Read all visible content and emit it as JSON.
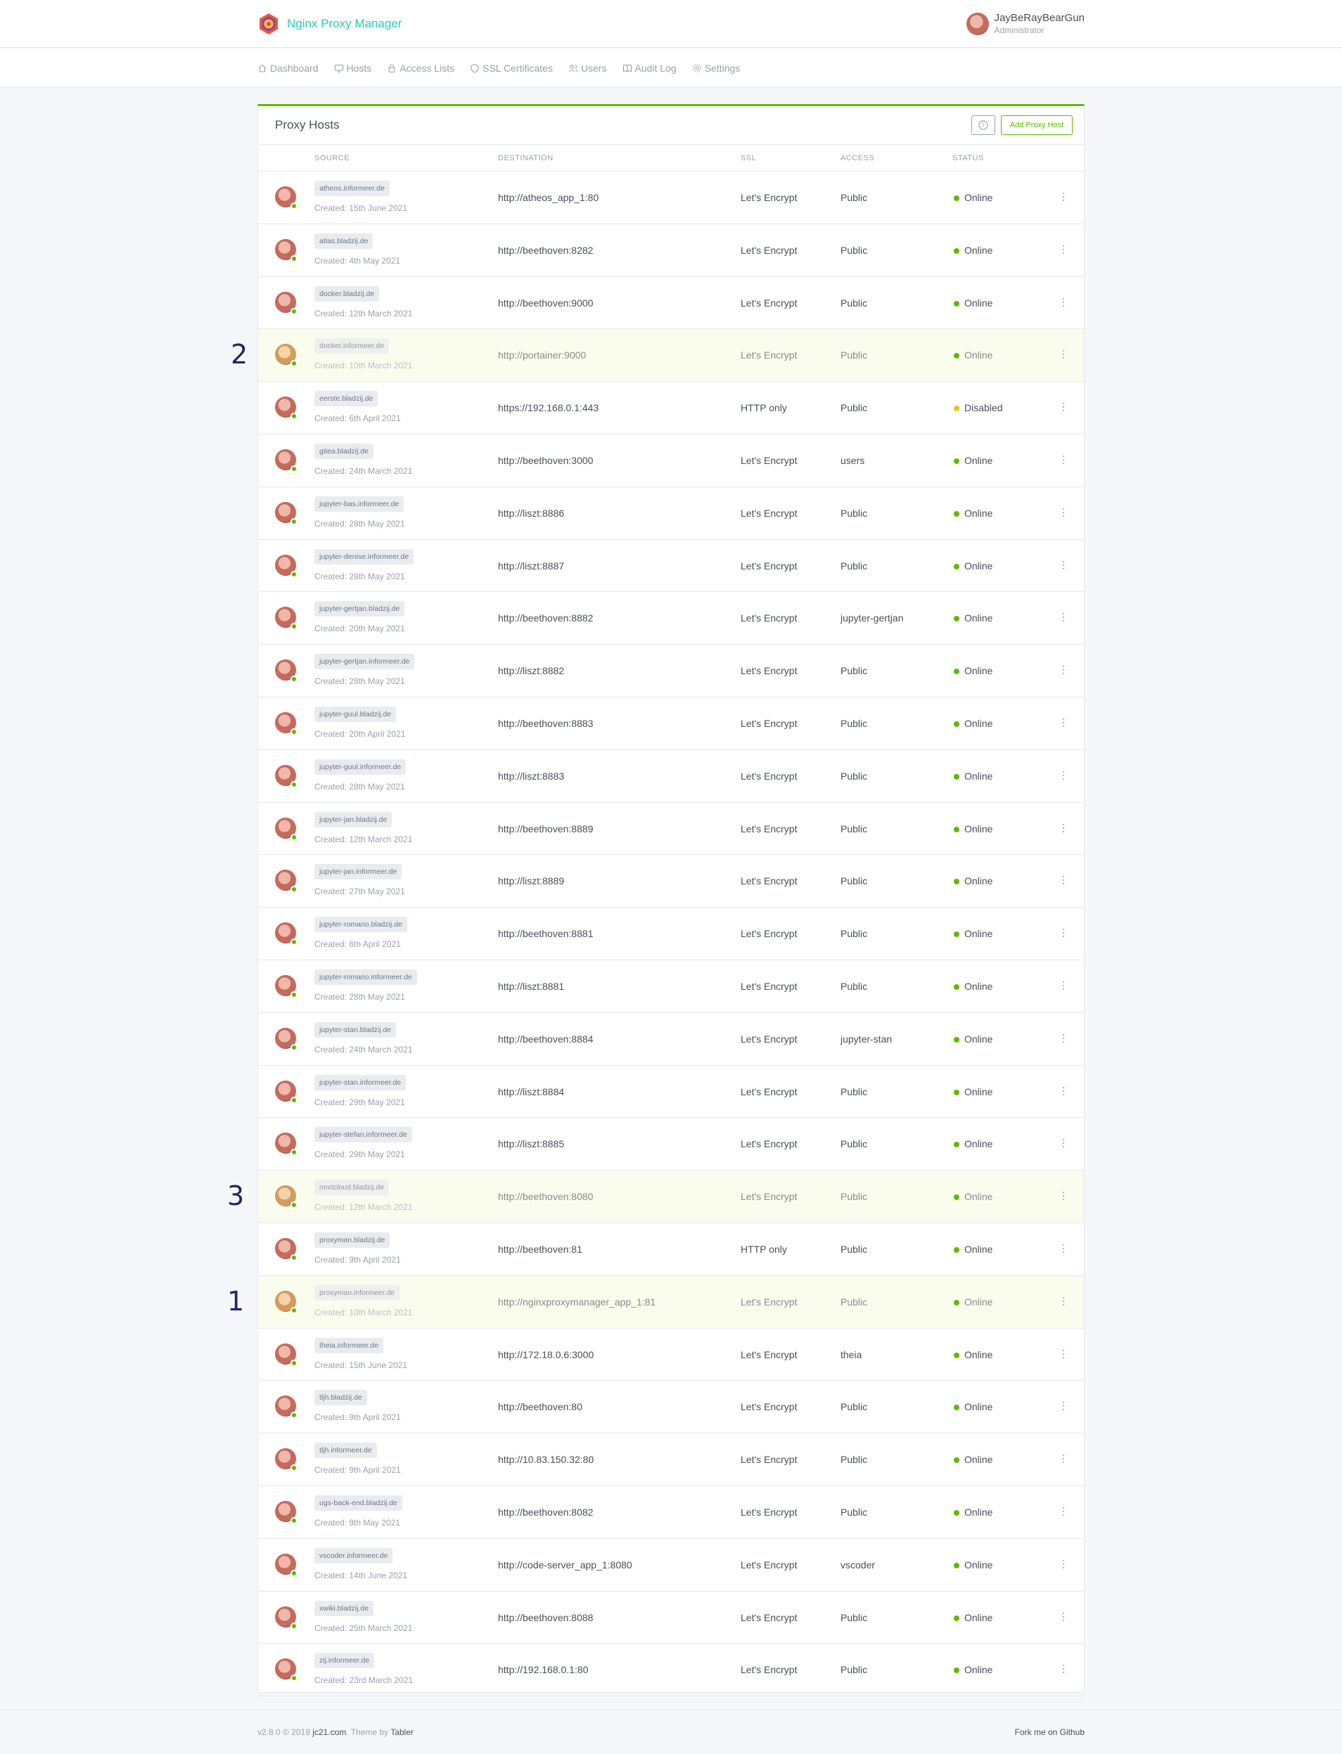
{
  "app": {
    "name": "Nginx Proxy Manager",
    "user_name": "JayBeRayBearGun",
    "user_role": "Administrator"
  },
  "nav": [
    {
      "label": "Dashboard",
      "icon": "home-icon"
    },
    {
      "label": "Hosts",
      "icon": "monitor-icon"
    },
    {
      "label": "Access Lists",
      "icon": "lock-icon"
    },
    {
      "label": "SSL Certificates",
      "icon": "shield-icon"
    },
    {
      "label": "Users",
      "icon": "users-icon"
    },
    {
      "label": "Audit Log",
      "icon": "book-icon"
    },
    {
      "label": "Settings",
      "icon": "gear-icon"
    }
  ],
  "card": {
    "title": "Proxy Hosts",
    "add_label": "Add Proxy Host"
  },
  "columns": [
    "SOURCE",
    "DESTINATION",
    "SSL",
    "ACCESS",
    "STATUS"
  ],
  "rows": [
    {
      "domain": "atheos.informeer.de",
      "created": "Created: 15th June 2021",
      "destination": "http://atheos_app_1:80",
      "ssl": "Let's Encrypt",
      "access": "Public",
      "status": "Online",
      "highlight": false
    },
    {
      "domain": "atlas.bladzij.de",
      "created": "Created: 4th May 2021",
      "destination": "http://beethoven:8282",
      "ssl": "Let's Encrypt",
      "access": "Public",
      "status": "Online",
      "highlight": false
    },
    {
      "domain": "docker.bladzij.de",
      "created": "Created: 12th March 2021",
      "destination": "http://beethoven:9000",
      "ssl": "Let's Encrypt",
      "access": "Public",
      "status": "Online",
      "highlight": false
    },
    {
      "domain": "docker.informeer.de",
      "created": "Created: 10th March 2021",
      "destination": "http://portainer:9000",
      "ssl": "Let's Encrypt",
      "access": "Public",
      "status": "Online",
      "highlight": true,
      "marker": "2"
    },
    {
      "domain": "eerste.bladzij.de",
      "created": "Created: 6th April 2021",
      "destination": "https://192.168.0.1:443",
      "ssl": "HTTP only",
      "access": "Public",
      "status": "Disabled",
      "highlight": false
    },
    {
      "domain": "gitea.bladzij.de",
      "created": "Created: 24th March 2021",
      "destination": "http://beethoven:3000",
      "ssl": "Let's Encrypt",
      "access": "users",
      "status": "Online",
      "highlight": false
    },
    {
      "domain": "jupyter-bas.informeer.de",
      "created": "Created: 28th May 2021",
      "destination": "http://liszt:8886",
      "ssl": "Let's Encrypt",
      "access": "Public",
      "status": "Online",
      "highlight": false
    },
    {
      "domain": "jupyter-denise.informeer.de",
      "created": "Created: 28th May 2021",
      "destination": "http://liszt:8887",
      "ssl": "Let's Encrypt",
      "access": "Public",
      "status": "Online",
      "highlight": false
    },
    {
      "domain": "jupyter-gertjan.bladzij.de",
      "created": "Created: 20th May 2021",
      "destination": "http://beethoven:8882",
      "ssl": "Let's Encrypt",
      "access": "jupyter-gertjan",
      "status": "Online",
      "highlight": false
    },
    {
      "domain": "jupyter-gertjan.informeer.de",
      "created": "Created: 28th May 2021",
      "destination": "http://liszt:8882",
      "ssl": "Let's Encrypt",
      "access": "Public",
      "status": "Online",
      "highlight": false
    },
    {
      "domain": "jupyter-guul.bladzij.de",
      "created": "Created: 20th April 2021",
      "destination": "http://beethoven:8883",
      "ssl": "Let's Encrypt",
      "access": "Public",
      "status": "Online",
      "highlight": false
    },
    {
      "domain": "jupyter-guul.informeer.de",
      "created": "Created: 28th May 2021",
      "destination": "http://liszt:8883",
      "ssl": "Let's Encrypt",
      "access": "Public",
      "status": "Online",
      "highlight": false
    },
    {
      "domain": "jupyter-jan.bladzij.de",
      "created": "Created: 12th March 2021",
      "destination": "http://beethoven:8889",
      "ssl": "Let's Encrypt",
      "access": "Public",
      "status": "Online",
      "highlight": false
    },
    {
      "domain": "jupyter-jan.informeer.de",
      "created": "Created: 27th May 2021",
      "destination": "http://liszt:8889",
      "ssl": "Let's Encrypt",
      "access": "Public",
      "status": "Online",
      "highlight": false
    },
    {
      "domain": "jupyter-romario.bladzij.de",
      "created": "Created: 6th April 2021",
      "destination": "http://beethoven:8881",
      "ssl": "Let's Encrypt",
      "access": "Public",
      "status": "Online",
      "highlight": false
    },
    {
      "domain": "jupyter-romario.informeer.de",
      "created": "Created: 28th May 2021",
      "destination": "http://liszt:8881",
      "ssl": "Let's Encrypt",
      "access": "Public",
      "status": "Online",
      "highlight": false
    },
    {
      "domain": "jupyter-stan.bladzij.de",
      "created": "Created: 24th March 2021",
      "destination": "http://beethoven:8884",
      "ssl": "Let's Encrypt",
      "access": "jupyter-stan",
      "status": "Online",
      "highlight": false
    },
    {
      "domain": "jupyter-stan.informeer.de",
      "created": "Created: 29th May 2021",
      "destination": "http://liszt:8884",
      "ssl": "Let's Encrypt",
      "access": "Public",
      "status": "Online",
      "highlight": false
    },
    {
      "domain": "jupyter-stefan.informeer.de",
      "created": "Created: 29th May 2021",
      "destination": "http://liszt:8885",
      "ssl": "Let's Encrypt",
      "access": "Public",
      "status": "Online",
      "highlight": false
    },
    {
      "domain": "nextcloud.bladzij.de",
      "created": "Created: 12th March 2021",
      "destination": "http://beethoven:8080",
      "ssl": "Let's Encrypt",
      "access": "Public",
      "status": "Online",
      "highlight": true,
      "marker": "3"
    },
    {
      "domain": "proxyman.bladzij.de",
      "created": "Created: 9th April 2021",
      "destination": "http://beethoven:81",
      "ssl": "HTTP only",
      "access": "Public",
      "status": "Online",
      "highlight": false
    },
    {
      "domain": "proxyman.informeer.de",
      "created": "Created: 10th March 2021",
      "destination": "http://nginxproxymanager_app_1:81",
      "ssl": "Let's Encrypt",
      "access": "Public",
      "status": "Online",
      "highlight": true,
      "marker": "1"
    },
    {
      "domain": "theia.informeer.de",
      "created": "Created: 15th June 2021",
      "destination": "http://172.18.0.6:3000",
      "ssl": "Let's Encrypt",
      "access": "theia",
      "status": "Online",
      "highlight": false
    },
    {
      "domain": "tljh.bladzij.de",
      "created": "Created: 9th April 2021",
      "destination": "http://beethoven:80",
      "ssl": "Let's Encrypt",
      "access": "Public",
      "status": "Online",
      "highlight": false
    },
    {
      "domain": "tljh.informeer.de",
      "created": "Created: 9th April 2021",
      "destination": "http://10.83.150.32:80",
      "ssl": "Let's Encrypt",
      "access": "Public",
      "status": "Online",
      "highlight": false
    },
    {
      "domain": "ugs-back-end.bladzij.de",
      "created": "Created: 9th May 2021",
      "destination": "http://beethoven:8082",
      "ssl": "Let's Encrypt",
      "access": "Public",
      "status": "Online",
      "highlight": false
    },
    {
      "domain": "vscoder.informeer.de",
      "created": "Created: 14th June 2021",
      "destination": "http://code-server_app_1:8080",
      "ssl": "Let's Encrypt",
      "access": "vscoder",
      "status": "Online",
      "highlight": false
    },
    {
      "domain": "xwiki.bladzij.de",
      "created": "Created: 25th March 2021",
      "destination": "http://beethoven:8088",
      "ssl": "Let's Encrypt",
      "access": "Public",
      "status": "Online",
      "highlight": false
    },
    {
      "domain": "zij.informeer.de",
      "created": "Created: 23rd March 2021",
      "destination": "http://192.168.0.1:80",
      "ssl": "Let's Encrypt",
      "access": "Public",
      "status": "Online",
      "highlight": false
    }
  ],
  "footer": {
    "version": "v2.8.0 © 2019 ",
    "site": "jc21.com",
    "theme_prefix": ". Theme by ",
    "theme": "Tabler",
    "fork": "Fork me on Github"
  },
  "colors": {
    "brand": "#2bcbba",
    "accent_green": "#5eba00",
    "status_disabled": "#f1c40f",
    "highlight_row": "#fafdee",
    "marker": "#22226e"
  }
}
